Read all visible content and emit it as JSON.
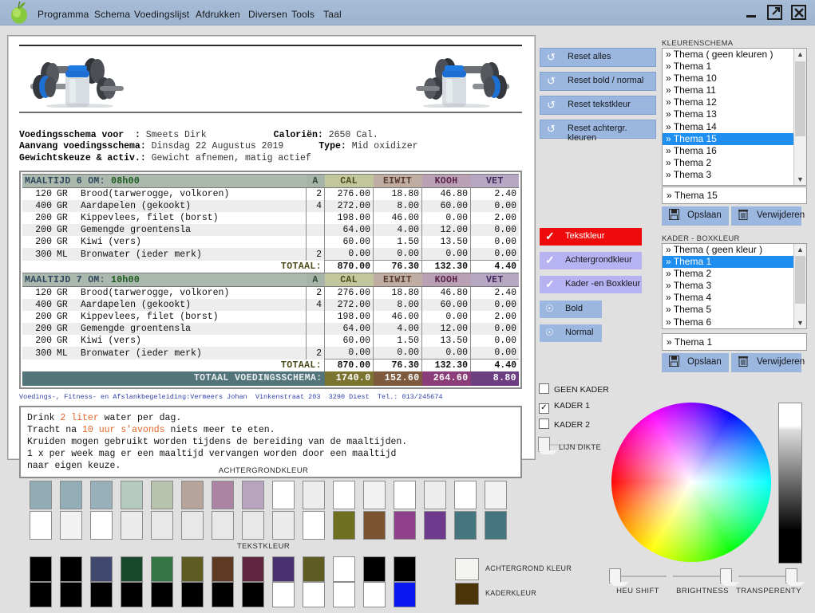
{
  "window": {
    "menu_items": [
      "Programma",
      "Schema",
      "Voedingslijst",
      "Afdrukken",
      "Diversen",
      "Tools",
      "Taal"
    ],
    "minimize": "minimize-icon",
    "restore": "restore-icon",
    "close": "X"
  },
  "document": {
    "info": [
      {
        "label": "Voedingsschema voor  ",
        "sep": ": ",
        "value": "Smeets Dirk",
        "label2": "Caloriën:",
        "value2": "2650 Cal."
      },
      {
        "label": "Aanvang voedingsschema",
        "sep": ": ",
        "value": "Dinsdag 22 Augustus 2019",
        "label2": "Type:",
        "value2": "Mid oxidizer"
      },
      {
        "label": "Gewichtskeuze & activ.",
        "sep": ": ",
        "value": "Gewicht afnemen, matig actief",
        "label2": "",
        "value2": ""
      }
    ],
    "columns": [
      "A",
      "CAL",
      "EIWIT",
      "KOOH",
      "VET"
    ],
    "meals": [
      {
        "title": "MAALTIJD 6 OM:",
        "time": "08h00",
        "rows": [
          {
            "qty": "120",
            "unit": "GR",
            "name": "Brood(tarwerogge, volkoren)",
            "a": "2",
            "cal": "276.00",
            "eiwit": "18.80",
            "kooh": "46.80",
            "vet": "2.40"
          },
          {
            "qty": "400",
            "unit": "GR",
            "name": "Aardapelen (gekookt)",
            "a": "4",
            "cal": "272.00",
            "eiwit": "8.00",
            "kooh": "60.00",
            "vet": "0.00"
          },
          {
            "qty": "200",
            "unit": "GR",
            "name": "Kippevlees, filet (borst)",
            "a": "",
            "cal": "198.00",
            "eiwit": "46.00",
            "kooh": "0.00",
            "vet": "2.00"
          },
          {
            "qty": "200",
            "unit": "GR",
            "name": "Gemengde groentensla",
            "a": "",
            "cal": "64.00",
            "eiwit": "4.00",
            "kooh": "12.00",
            "vet": "0.00"
          },
          {
            "qty": "200",
            "unit": "GR",
            "name": "Kiwi (vers)",
            "a": "",
            "cal": "60.00",
            "eiwit": "1.50",
            "kooh": "13.50",
            "vet": "0.00"
          },
          {
            "qty": "300",
            "unit": "ML",
            "name": "Bronwater (ieder merk)",
            "a": "2",
            "cal": "0.00",
            "eiwit": "0.00",
            "kooh": "0.00",
            "vet": "0.00"
          }
        ],
        "total_label": "TOTAAL:",
        "totals": {
          "cal": "870.00",
          "eiwit": "76.30",
          "kooh": "132.30",
          "vet": "4.40"
        }
      },
      {
        "title": "MAALTIJD 7 OM:",
        "time": "10h00",
        "rows": [
          {
            "qty": "120",
            "unit": "GR",
            "name": "Brood(tarwerogge, volkoren)",
            "a": "2",
            "cal": "276.00",
            "eiwit": "18.80",
            "kooh": "46.80",
            "vet": "2.40"
          },
          {
            "qty": "400",
            "unit": "GR",
            "name": "Aardapelen (gekookt)",
            "a": "4",
            "cal": "272.00",
            "eiwit": "8.00",
            "kooh": "60.00",
            "vet": "0.00"
          },
          {
            "qty": "200",
            "unit": "GR",
            "name": "Kippevlees, filet (borst)",
            "a": "",
            "cal": "198.00",
            "eiwit": "46.00",
            "kooh": "0.00",
            "vet": "2.00"
          },
          {
            "qty": "200",
            "unit": "GR",
            "name": "Gemengde groentensla",
            "a": "",
            "cal": "64.00",
            "eiwit": "4.00",
            "kooh": "12.00",
            "vet": "0.00"
          },
          {
            "qty": "200",
            "unit": "GR",
            "name": "Kiwi (vers)",
            "a": "",
            "cal": "60.00",
            "eiwit": "1.50",
            "kooh": "13.50",
            "vet": "0.00"
          },
          {
            "qty": "300",
            "unit": "ML",
            "name": "Bronwater (ieder merk)",
            "a": "2",
            "cal": "0.00",
            "eiwit": "0.00",
            "kooh": "0.00",
            "vet": "0.00"
          }
        ],
        "total_label": "TOTAAL:",
        "totals": {
          "cal": "870.00",
          "eiwit": "76.30",
          "kooh": "132.30",
          "vet": "4.40"
        }
      }
    ],
    "grand_label": "TOTAAL VOEDINGSSCHEMA:",
    "grand_totals": {
      "cal": "1740.0",
      "eiwit": "152.60",
      "kooh": "264.60",
      "vet": "8.80"
    },
    "footer": "Voedings-, Fitness- en Afslankbegeleiding:Vermeers Johan  Vinkenstraat 203  3290 Diest  Tel.: 013/245674",
    "advice": [
      {
        "pre": "Drink ",
        "hl": "2 liter",
        "post": " water per dag."
      },
      {
        "pre": "Tracht na ",
        "hl": "10 uur s'avonds",
        "post": " niets meer te eten."
      },
      {
        "pre": "Kruiden mogen gebruikt worden tijdens de bereiding van de maaltijden.",
        "hl": "",
        "post": ""
      },
      {
        "pre": "1 x per week mag er een maaltijd vervangen worden door een maaltijd",
        "hl": "",
        "post": ""
      },
      {
        "pre": "naar eigen keuze.",
        "hl": "",
        "post": ""
      }
    ]
  },
  "reset_buttons": [
    {
      "label": "Reset alles",
      "icon": "undo-icon"
    },
    {
      "label": "Reset bold / normal",
      "icon": "undo-icon"
    },
    {
      "label": "Reset tekstkleur",
      "icon": "undo-icon"
    },
    {
      "label": "Reset achtergr. kleuren",
      "icon": "undo-icon"
    }
  ],
  "mode_buttons": [
    {
      "label": "Tekstkleur",
      "icon": "check-icon",
      "active": true
    },
    {
      "label": "Achtergrondkleur",
      "icon": "check-icon",
      "active": false
    },
    {
      "label": "Kader -en Boxkleur",
      "icon": "check-icon",
      "active": false
    },
    {
      "label": "Bold",
      "icon": "circle-check-icon",
      "active": false
    },
    {
      "label": "Normal",
      "icon": "circle-check-icon",
      "active": false
    }
  ],
  "frame_options": [
    {
      "label": "GEEN KADER",
      "checked": false
    },
    {
      "label": "KADER 1",
      "checked": true
    },
    {
      "label": "KADER 2",
      "checked": false
    }
  ],
  "line_thickness_label": "LIJN DIKTE",
  "kleurenschema": {
    "title": "KLEURENSCHEMA",
    "items": [
      "» Thema ( geen kleuren )",
      "» Thema 1",
      "» Thema 10",
      "» Thema 11",
      "» Thema 12",
      "» Thema 13",
      "» Thema 14",
      "» Thema 15",
      "» Thema 16",
      "» Thema 2",
      "» Thema 3"
    ],
    "selected_index": 7,
    "field_value": "» Thema 15",
    "save_label": "Opslaan",
    "delete_label": "Verwijderen"
  },
  "kaderboxkleur": {
    "title": "KADER - BOXKLEUR",
    "items": [
      "» Thema ( geen kleur )",
      "» Thema 1",
      "» Thema 2",
      "» Thema 3",
      "» Thema 4",
      "» Thema 5",
      "» Thema 6"
    ],
    "selected_index": 1,
    "field_value": "» Thema 1",
    "save_label": "Opslaan",
    "delete_label": "Verwijderen"
  },
  "palettes": {
    "background_title": "ACHTERGRONDKLEUR",
    "text_title": "TEKSTKLEUR",
    "background_row1": [
      "#92acb5",
      "#94aeb7",
      "#97b0b9",
      "#b6cbc0",
      "#b7c3ad",
      "#b6a49a",
      "#ab84a4",
      "#b7a4bf",
      "#ffffff",
      "#ededed",
      "#ffffff",
      "#f2f2f2",
      "#ffffff",
      "#ededed",
      "#ffffff",
      "#f2f2f2"
    ],
    "background_row2": [
      "#ffffff",
      "#f2f2f2",
      "#ffffff",
      "#ebebeb",
      "#e8e8e8",
      "#e8e8e8",
      "#e8e8e8",
      "#e8e8e8",
      "#ebebeb",
      "#ffffff",
      "#6e701f",
      "#7b5431",
      "#90418b",
      "#6d3a8e",
      "#45757e",
      "#45757e"
    ],
    "text_row1": [
      "#000000",
      "#000000",
      "#40486f",
      "#17492a",
      "#357744",
      "#5e5c22",
      "#5e3a25",
      "#62253f",
      "#4a3172",
      "#5e5c22",
      "#ffffff",
      "#000000",
      "#000000"
    ],
    "text_row2": [
      "#000000",
      "#000000",
      "#000000",
      "#000000",
      "#000000",
      "#000000",
      "#000000",
      "#000000",
      "#ffffff",
      "#ffffff",
      "#ffffff",
      "#ffffff",
      "#0a18f0"
    ],
    "special": [
      {
        "label": "ACHTERGROND KLEUR",
        "color": "#f4f4f0"
      },
      {
        "label": "KADERKLEUR",
        "color": "#4b3508"
      }
    ]
  },
  "sliders": [
    {
      "label": "HEU SHIFT",
      "position": 0
    },
    {
      "label": "BRIGHTNESS",
      "position": 100
    },
    {
      "label": "TRANSPERENTY",
      "position": 100
    }
  ]
}
